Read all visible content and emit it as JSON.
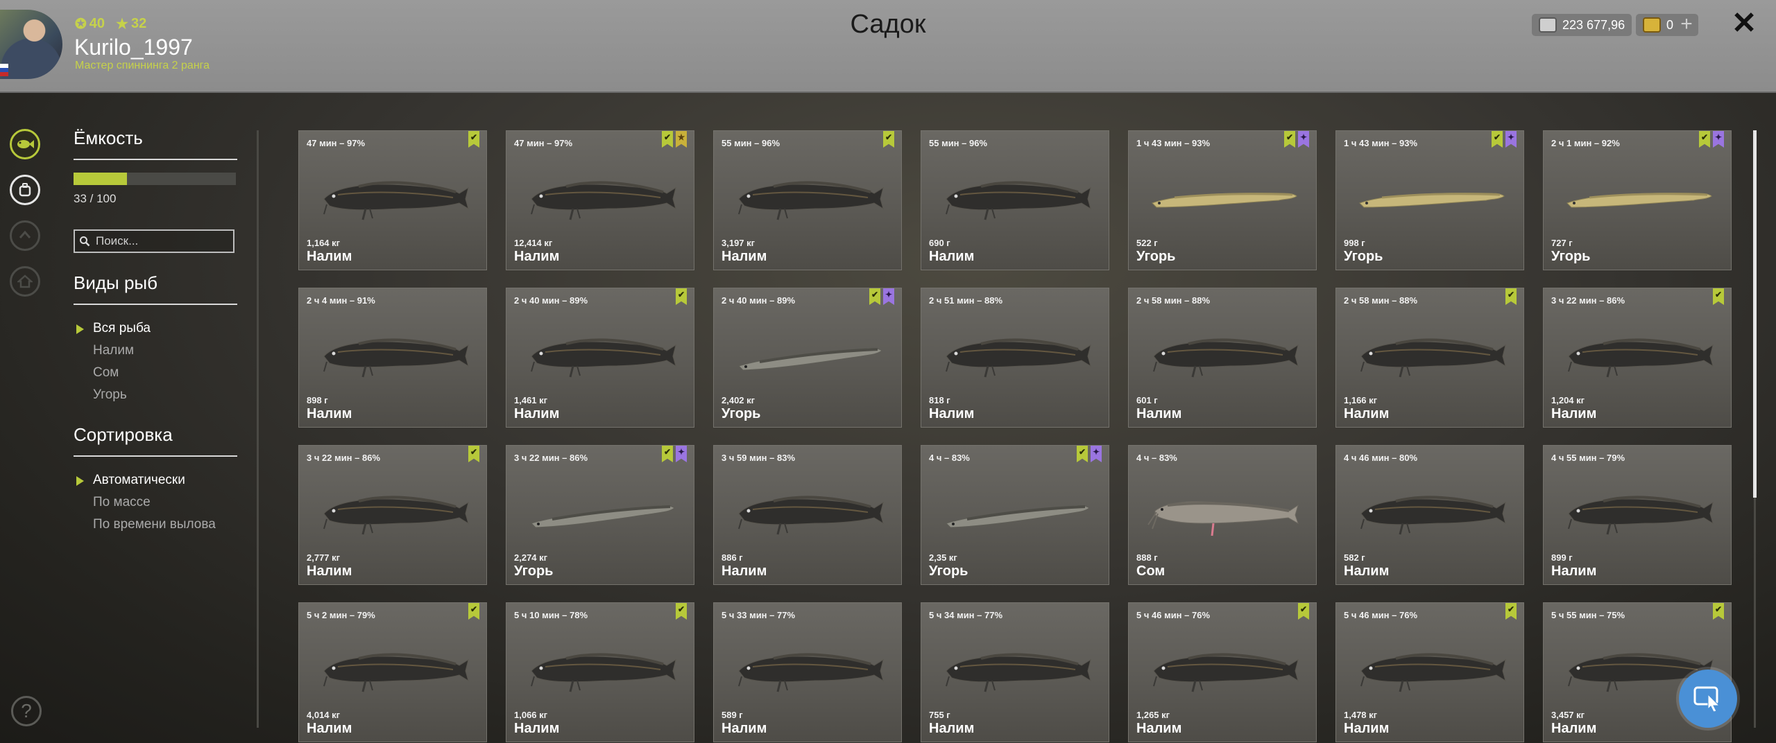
{
  "header": {
    "title": "Садок",
    "username": "Kurilo_1997",
    "rank": "Мастер спиннинга 2 ранга",
    "level": "40",
    "stars": "32",
    "silver": "223 677,96",
    "gold": "0",
    "plus": "+",
    "close": "✕"
  },
  "panel": {
    "capacity_title": "Ёмкость",
    "capacity_text": "33 / 100",
    "capacity_fraction": 0.33,
    "search_placeholder": "Поиск...",
    "species_title": "Виды рыб",
    "species": [
      "Вся рыба",
      "Налим",
      "Сом",
      "Угорь"
    ],
    "sort_title": "Сортировка",
    "sort": [
      "Автоматически",
      "По массе",
      "По времени вылова"
    ]
  },
  "help": "?",
  "fish": [
    {
      "time": "47 мин – 97%",
      "weight": "1,164 кг",
      "name": "Налим",
      "badges": [
        "check"
      ],
      "kind": "burbot"
    },
    {
      "time": "47 мин – 97%",
      "weight": "12,414 кг",
      "name": "Налим",
      "badges": [
        "check",
        "gold"
      ],
      "kind": "burbot"
    },
    {
      "time": "55 мин – 96%",
      "weight": "3,197 кг",
      "name": "Налим",
      "badges": [
        "check"
      ],
      "kind": "burbot"
    },
    {
      "time": "55 мин – 96%",
      "weight": "690 г",
      "name": "Налим",
      "badges": [],
      "kind": "burbot"
    },
    {
      "time": "1 ч 43 мин – 93%",
      "weight": "522 г",
      "name": "Угорь",
      "badges": [
        "check",
        "purple"
      ],
      "kind": "eel-light"
    },
    {
      "time": "1 ч 43 мин – 93%",
      "weight": "998 г",
      "name": "Угорь",
      "badges": [
        "check",
        "purple"
      ],
      "kind": "eel-light"
    },
    {
      "time": "2 ч 1 мин – 92%",
      "weight": "727 г",
      "name": "Угорь",
      "badges": [
        "check",
        "purple"
      ],
      "kind": "eel-light"
    },
    {
      "time": "2 ч 4 мин – 91%",
      "weight": "898 г",
      "name": "Налим",
      "badges": [],
      "kind": "burbot"
    },
    {
      "time": "2 ч 40 мин – 89%",
      "weight": "1,461 кг",
      "name": "Налим",
      "badges": [
        "check"
      ],
      "kind": "burbot"
    },
    {
      "time": "2 ч 40 мин – 89%",
      "weight": "2,402 кг",
      "name": "Угорь",
      "badges": [
        "check",
        "purple"
      ],
      "kind": "eel"
    },
    {
      "time": "2 ч 51 мин – 88%",
      "weight": "818 г",
      "name": "Налим",
      "badges": [],
      "kind": "burbot"
    },
    {
      "time": "2 ч 58 мин – 88%",
      "weight": "601 г",
      "name": "Налим",
      "badges": [],
      "kind": "burbot"
    },
    {
      "time": "2 ч 58 мин – 88%",
      "weight": "1,166 кг",
      "name": "Налим",
      "badges": [
        "check"
      ],
      "kind": "burbot"
    },
    {
      "time": "3 ч 22 мин – 86%",
      "weight": "1,204 кг",
      "name": "Налим",
      "badges": [
        "check"
      ],
      "kind": "burbot"
    },
    {
      "time": "3 ч 22 мин – 86%",
      "weight": "2,777 кг",
      "name": "Налим",
      "badges": [
        "check"
      ],
      "kind": "burbot"
    },
    {
      "time": "3 ч 22 мин – 86%",
      "weight": "2,274 кг",
      "name": "Угорь",
      "badges": [
        "check",
        "purple"
      ],
      "kind": "eel"
    },
    {
      "time": "3 ч 59 мин – 83%",
      "weight": "886 г",
      "name": "Налим",
      "badges": [],
      "kind": "burbot"
    },
    {
      "time": "4 ч – 83%",
      "weight": "2,35 кг",
      "name": "Угорь",
      "badges": [
        "check",
        "purple"
      ],
      "kind": "eel"
    },
    {
      "time": "4 ч – 83%",
      "weight": "888 г",
      "name": "Сом",
      "badges": [],
      "kind": "catfish"
    },
    {
      "time": "4 ч 46 мин – 80%",
      "weight": "582 г",
      "name": "Налим",
      "badges": [],
      "kind": "burbot"
    },
    {
      "time": "4 ч 55 мин – 79%",
      "weight": "899 г",
      "name": "Налим",
      "badges": [],
      "kind": "burbot"
    },
    {
      "time": "5 ч 2 мин – 79%",
      "weight": "4,014 кг",
      "name": "Налим",
      "badges": [
        "check"
      ],
      "kind": "burbot"
    },
    {
      "time": "5 ч 10 мин – 78%",
      "weight": "1,066 кг",
      "name": "Налим",
      "badges": [
        "check"
      ],
      "kind": "burbot"
    },
    {
      "time": "5 ч 33 мин – 77%",
      "weight": "589 г",
      "name": "Налим",
      "badges": [],
      "kind": "burbot"
    },
    {
      "time": "5 ч 34 мин – 77%",
      "weight": "755 г",
      "name": "Налим",
      "badges": [],
      "kind": "burbot"
    },
    {
      "time": "5 ч 46 мин – 76%",
      "weight": "1,265 кг",
      "name": "Налим",
      "badges": [
        "check"
      ],
      "kind": "burbot"
    },
    {
      "time": "5 ч 46 мин – 76%",
      "weight": "1,478 кг",
      "name": "Налим",
      "badges": [
        "check"
      ],
      "kind": "burbot"
    },
    {
      "time": "5 ч 55 мин – 75%",
      "weight": "3,457 кг",
      "name": "Налим",
      "badges": [
        "check"
      ],
      "kind": "burbot"
    }
  ],
  "colors": {
    "accent": "#b7c93a",
    "purple_badge": "#9a75e0",
    "gold_badge": "#c9b13a"
  }
}
